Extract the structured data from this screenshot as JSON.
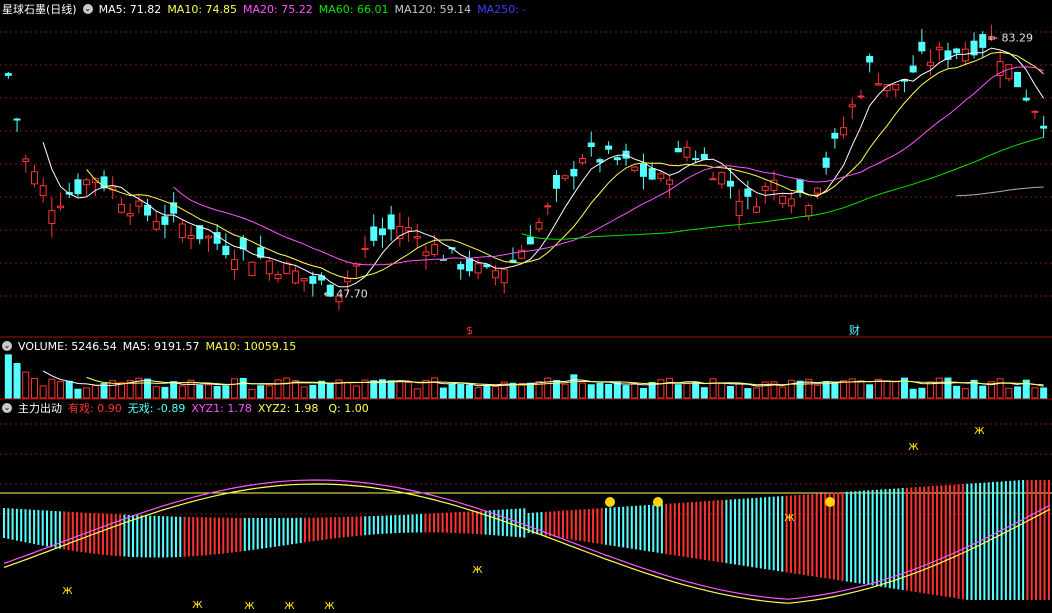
{
  "colors": {
    "up": "#ff3232",
    "down": "#54ffff",
    "ma5": "#ffffff",
    "ma10": "#ffff54",
    "ma20": "#ff54ff",
    "ma60": "#00e600",
    "ma120": "#b0b0b0",
    "ma250": "#3c3cff",
    "vol_ma5": "#ffffff",
    "vol_ma10": "#ffff54"
  },
  "header": {
    "title": "星球石墨(日线)",
    "ma5": "MA5: 71.82",
    "ma10": "MA10: 74.85",
    "ma20": "MA20: 75.22",
    "ma60": "MA60: 66.01",
    "ma120": "MA120: 59.14",
    "ma250": "MA250: -"
  },
  "volume_header": {
    "label": "VOLUME: 5246.54",
    "ma5": "MA5: 9191.57",
    "ma10": "MA10: 10059.15"
  },
  "indicator_header": {
    "name": "主力出动",
    "yx": "有戏: 0.90",
    "wx": "无戏: -0.89",
    "xyz1": "XYZ1: 1.78",
    "xyz2": "XYZ2: 1.98",
    "q": "Q: 1.00"
  },
  "annotations": {
    "high": "83.29",
    "low": "47.70",
    "marker_s": "$",
    "marker_cai": "财"
  },
  "chart_data": [
    {
      "type": "candlestick",
      "title": "星球石墨(日线)",
      "ylim": [
        44,
        86
      ],
      "marked_high": 83.29,
      "marked_low": 47.7,
      "x_count": 120
    },
    {
      "type": "bar",
      "title": "VOLUME",
      "last_value": 5246.54,
      "ma5": 9191.57,
      "ma10": 10059.15
    },
    {
      "type": "bar",
      "title": "主力出动",
      "series": [
        {
          "name": "有戏",
          "last": 0.9
        },
        {
          "name": "无戏",
          "last": -0.89
        },
        {
          "name": "XYZ1",
          "last": 1.78
        },
        {
          "name": "XYZ2",
          "last": 1.98
        },
        {
          "name": "Q",
          "last": 1.0
        }
      ]
    }
  ]
}
